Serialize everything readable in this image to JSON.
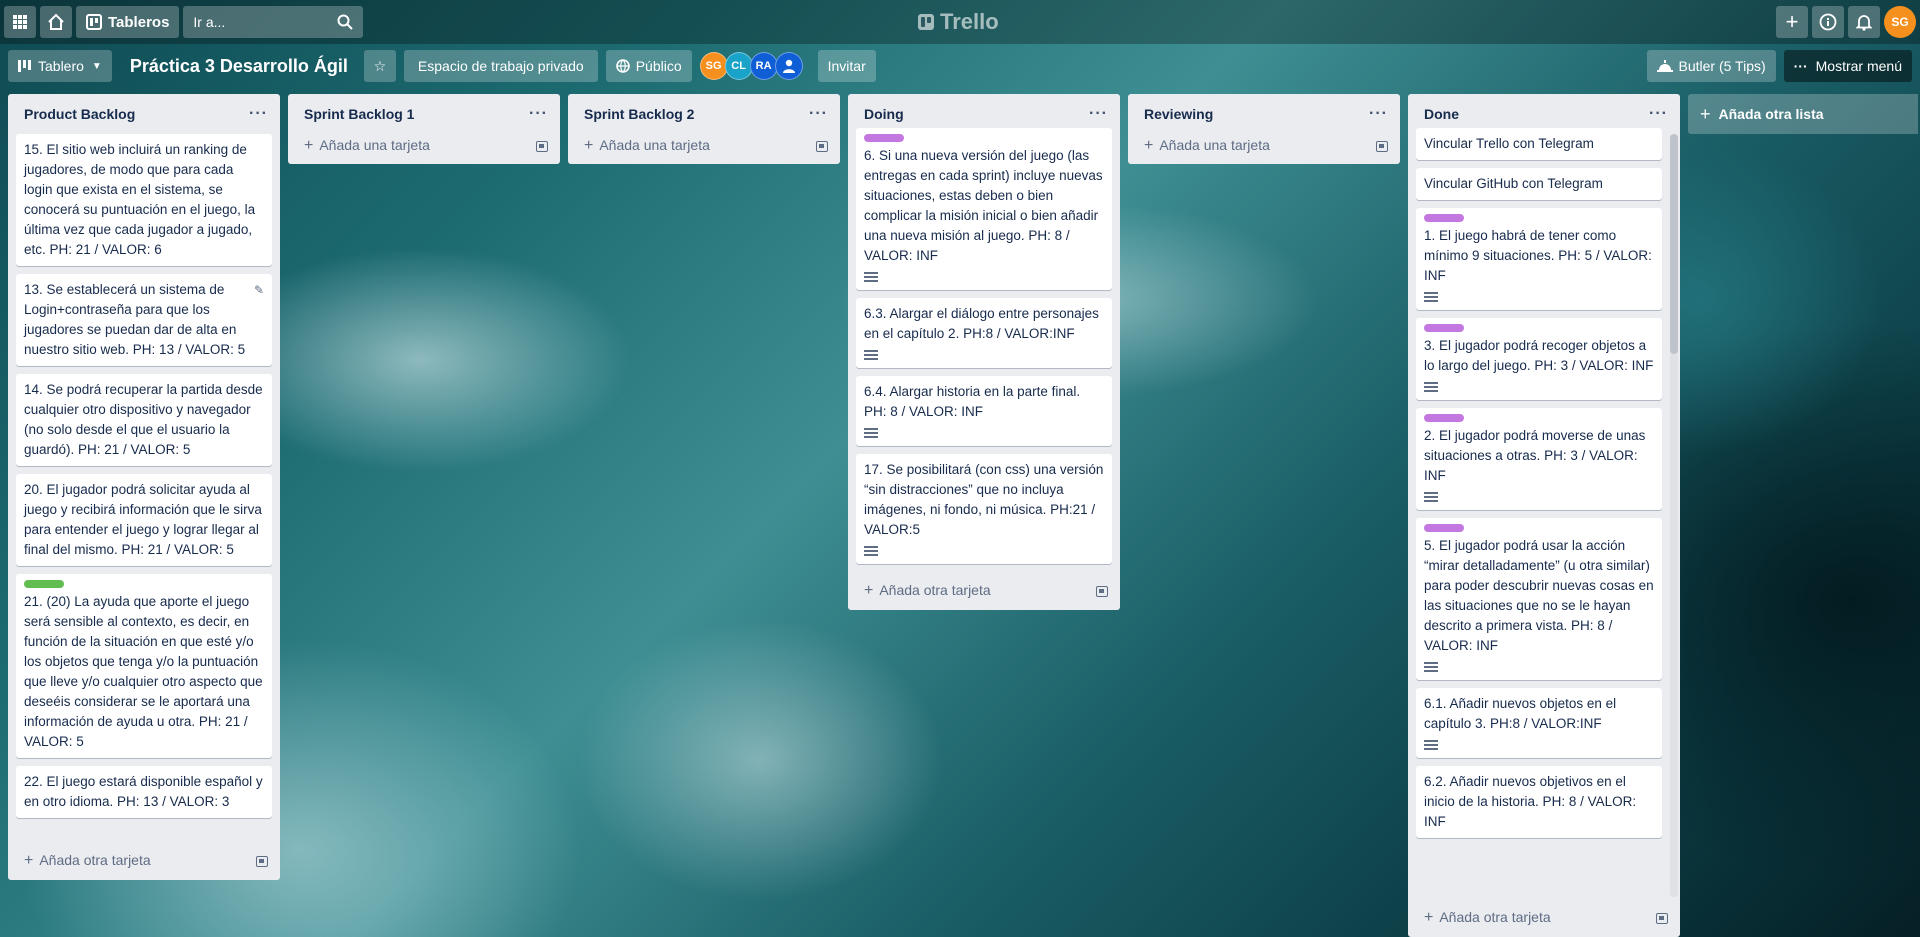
{
  "topbar": {
    "boards_label": "Tableros",
    "search_placeholder": "Ir a...",
    "logo_text": "Trello",
    "user_initials": "SG"
  },
  "board_header": {
    "view_label": "Tablero",
    "title": "Práctica 3 Desarrollo Ágil",
    "workspace_label": "Espacio de trabajo privado",
    "visibility_label": "Público",
    "members": [
      {
        "initials": "SG",
        "color": "#f5901e"
      },
      {
        "initials": "CL",
        "color": "#1aa3c9"
      },
      {
        "initials": "RA",
        "color": "#0f5ed6"
      },
      {
        "initials": "",
        "color": "#0f5ed6"
      }
    ],
    "invite_label": "Invitar",
    "butler_label": "Butler (5 Tips)",
    "menu_label": "Mostrar menú"
  },
  "labels": {
    "purple": "#c377e0",
    "green": "#61bd4f"
  },
  "lists": {
    "product_backlog": {
      "title": "Product Backlog",
      "footer": "Añada otra tarjeta",
      "cards": [
        {
          "text": "15. El sitio web incluirá un ranking de jugadores, de modo que para cada login que exista en el sistema, se conocerá su puntuación en el juego, la última vez que cada jugador a jugado, etc. PH: 21 / VALOR: 6"
        },
        {
          "text": "13. Se establecerá un sistema de Login+contraseña para que los jugadores se puedan dar de alta en nuestro sitio web. PH: 13 / VALOR: 5"
        },
        {
          "text": "14. Se podrá recuperar la partida desde cualquier otro dispositivo y navegador (no solo desde el que el usuario la guardó). PH: 21 / VALOR: 5"
        },
        {
          "text": "20. El jugador podrá solicitar ayuda al juego y recibirá información que le sirva para entender el juego y lograr llegar al final del mismo. PH: 21 / VALOR: 5"
        },
        {
          "text": "21. (20) La ayuda que aporte el juego será sensible al contexto, es decir, en función de la situación en que esté y/o los objetos que tenga y/o la puntuación que lleve y/o cualquier otro aspecto que deseéis considerar se le aportará una información de ayuda u otra. PH: 21 / VALOR: 5"
        },
        {
          "text": "22. El juego estará disponible español y en otro idioma. PH: 13 / VALOR: 3"
        }
      ]
    },
    "sprint_backlog_1": {
      "title": "Sprint Backlog 1",
      "footer": "Añada una tarjeta"
    },
    "sprint_backlog_2": {
      "title": "Sprint Backlog 2",
      "footer": "Añada una tarjeta"
    },
    "doing": {
      "title": "Doing",
      "footer": "Añada otra tarjeta",
      "cards": [
        {
          "text": "6. Si una nueva versión del juego (las entregas en cada sprint) incluye nuevas situaciones, estas deben o bien complicar la misión inicial o bien añadir una nueva misión al juego. PH: 8 / VALOR: INF"
        },
        {
          "text": "6.3. Alargar el diálogo entre personajes en el capítulo 2. PH:8 / VALOR:INF"
        },
        {
          "text": "6.4. Alargar historia en la parte final. PH: 8 / VALOR: INF"
        },
        {
          "text": "17. Se posibilitará (con css) una versión “sin distracciones” que no incluya imágenes, ni fondo, ni música. PH:21 / VALOR:5"
        }
      ]
    },
    "reviewing": {
      "title": "Reviewing",
      "footer": "Añada una tarjeta"
    },
    "done": {
      "title": "Done",
      "footer": "Añada otra tarjeta",
      "cards": [
        {
          "text": "Vincular Trello con Telegram"
        },
        {
          "text": "Vincular GitHub con Telegram"
        },
        {
          "text": "1. El juego habrá de tener como mínimo 9 situaciones. PH: 5 / VALOR: INF"
        },
        {
          "text": "3. El jugador podrá recoger objetos a lo largo del juego. PH: 3 / VALOR: INF"
        },
        {
          "text": "2. El jugador podrá moverse de unas situaciones a otras. PH: 3 / VALOR: INF"
        },
        {
          "text": "5. El jugador podrá usar la acción “mirar detalladamente” (u otra similar) para poder descubrir nuevas cosas en las situaciones que no se le hayan descrito a primera vista. PH: 8 / VALOR: INF"
        },
        {
          "text": "6.1. Añadir nuevos objetos en el capítulo 3. PH:8 / VALOR:INF"
        },
        {
          "text": "6.2. Añadir nuevos objetivos en el inicio de la historia. PH: 8 / VALOR: INF"
        }
      ]
    }
  },
  "add_list_label": "Añada otra lista"
}
